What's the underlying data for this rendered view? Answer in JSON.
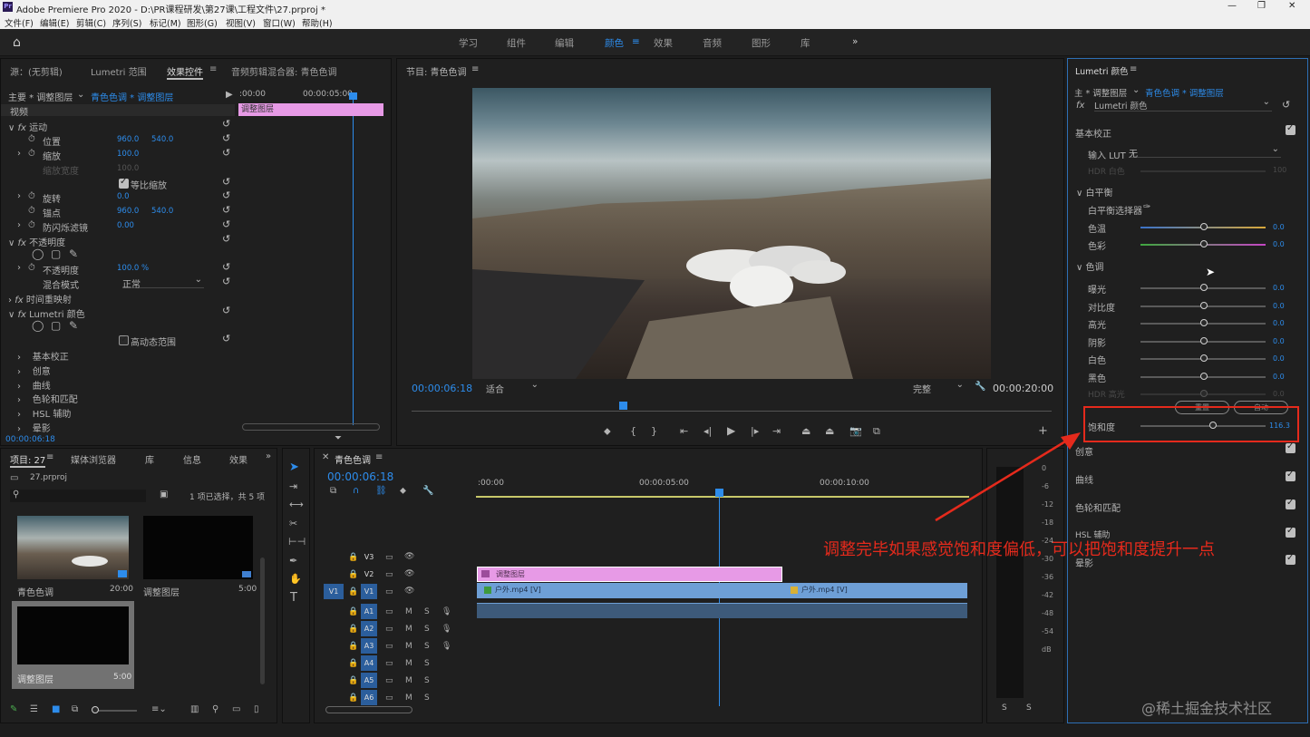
{
  "titlebar": {
    "title": "Adobe Premiere Pro 2020 - D:\\PR课程研发\\第27课\\工程文件\\27.prproj *",
    "min": "—",
    "max": "❐",
    "close": "✕"
  },
  "menu": [
    "文件(F)",
    "编辑(E)",
    "剪辑(C)",
    "序列(S)",
    "标记(M)",
    "图形(G)",
    "视图(V)",
    "窗口(W)",
    "帮助(H)"
  ],
  "workspaces": [
    "学习",
    "组件",
    "编辑",
    "颜色",
    "效果",
    "音频",
    "图形",
    "库"
  ],
  "workspaces_active": "颜色",
  "effects_panel": {
    "tabs": [
      "源：(无剪辑)",
      "Lumetri 范围",
      "效果控件",
      "音频剪辑混合器: 青色色调"
    ],
    "master_label": "主要 * 调整图层",
    "clip_label": "青色色调 * 调整图层",
    "ruler_start": ":00:00",
    "ruler_mid": "00:00:05:00",
    "clip_bar": "调整图层",
    "video_header": "视频",
    "rows": {
      "motion": "运动",
      "position": "位置",
      "position_x": "960.0",
      "position_y": "540.0",
      "scale": "缩放",
      "scale_v": "100.0",
      "scale_w": "缩放宽度",
      "scale_w_v": "100.0",
      "uniform": "等比缩放",
      "rotation": "旋转",
      "rotation_v": "0.0",
      "anchor": "锚点",
      "anchor_x": "960.0",
      "anchor_y": "540.0",
      "antiflicker": "防闪烁滤镜",
      "antiflicker_v": "0.00",
      "opacity_grp": "不透明度",
      "opacity": "不透明度",
      "opacity_v": "100.0 %",
      "blend": "混合模式",
      "blend_v": "正常",
      "timeremap": "时间重映射",
      "lumetri": "Lumetri 颜色",
      "hdr": "高动态范围",
      "basic": "基本校正",
      "creative": "创意",
      "curves": "曲线",
      "wheels": "色轮和匹配",
      "hsl": "HSL 辅助",
      "vignette": "晕影"
    },
    "timecode": "00:00:06:18"
  },
  "program": {
    "title": "节目: 青色色调",
    "timecode": "00:00:06:18",
    "fit": "适合",
    "quality": "完整",
    "duration": "00:00:20:00"
  },
  "project": {
    "tabs": [
      "项目: 27",
      "媒体浏览器",
      "库",
      "信息",
      "效果"
    ],
    "file": "27.prproj",
    "selection": "1 项已选择，共 5 项",
    "items": [
      {
        "name": "青色色调",
        "dur": "20:00"
      },
      {
        "name": "调整图层",
        "dur": "5:00"
      },
      {
        "name": "调整图层",
        "dur": "5:00"
      }
    ]
  },
  "timeline": {
    "title": "青色色调",
    "timecode": "00:00:06:18",
    "ruler": [
      ":00:00",
      "00:00:05:00",
      "00:00:10:00"
    ],
    "tracks_v": [
      "V3",
      "V2",
      "V1"
    ],
    "tracks_a": [
      "A1",
      "A2",
      "A3",
      "A4",
      "A5",
      "A6"
    ],
    "src_v": "V1",
    "clip_adj": "调整图层",
    "clip_a": "户外.mp4 [V]",
    "clip_b": "户外.mp4 [V]",
    "meter_scale": [
      "0",
      "-6",
      "-12",
      "-18",
      "-24",
      "-30",
      "-36",
      "-42",
      "-48",
      "-54",
      "dB"
    ],
    "meter_solo": [
      "S",
      "S"
    ]
  },
  "lumetri": {
    "title": "Lumetri 颜色",
    "master": "主 * 调整图层",
    "clip": "青色色调 * 调整图层",
    "effect": "Lumetri 颜色",
    "basic": "基本校正",
    "lut_label": "输入 LUT",
    "lut_value": "无",
    "hdr_white": "HDR 白色",
    "hdr_white_v": "100",
    "wb": "白平衡",
    "wb_selector": "白平衡选择器",
    "temp": "色温",
    "temp_v": "0.0",
    "tint": "色彩",
    "tint_v": "0.0",
    "tone": "色调",
    "sliders": [
      {
        "label": "曝光",
        "value": "0.0"
      },
      {
        "label": "对比度",
        "value": "0.0"
      },
      {
        "label": "高光",
        "value": "0.0"
      },
      {
        "label": "阴影",
        "value": "0.0"
      },
      {
        "label": "白色",
        "value": "0.0"
      },
      {
        "label": "黑色",
        "value": "0.0"
      },
      {
        "label": "HDR 高光",
        "value": "0.0"
      }
    ],
    "reset_btn": "重置",
    "auto_btn": "自动",
    "saturation": "饱和度",
    "saturation_v": "116.3",
    "sections": [
      "创意",
      "曲线",
      "色轮和匹配",
      "HSL 辅助",
      "晕影"
    ]
  },
  "annotation": {
    "text": "调整完毕如果感觉饱和度偏低，可以把饱和度提升一点",
    "color": "#e52a1c"
  },
  "watermark": "@稀土掘金技术社区",
  "colors": {
    "accent": "#2d8ceb",
    "adjustment_clip": "#e79ae6",
    "video_clip": "#6e9fd6"
  }
}
